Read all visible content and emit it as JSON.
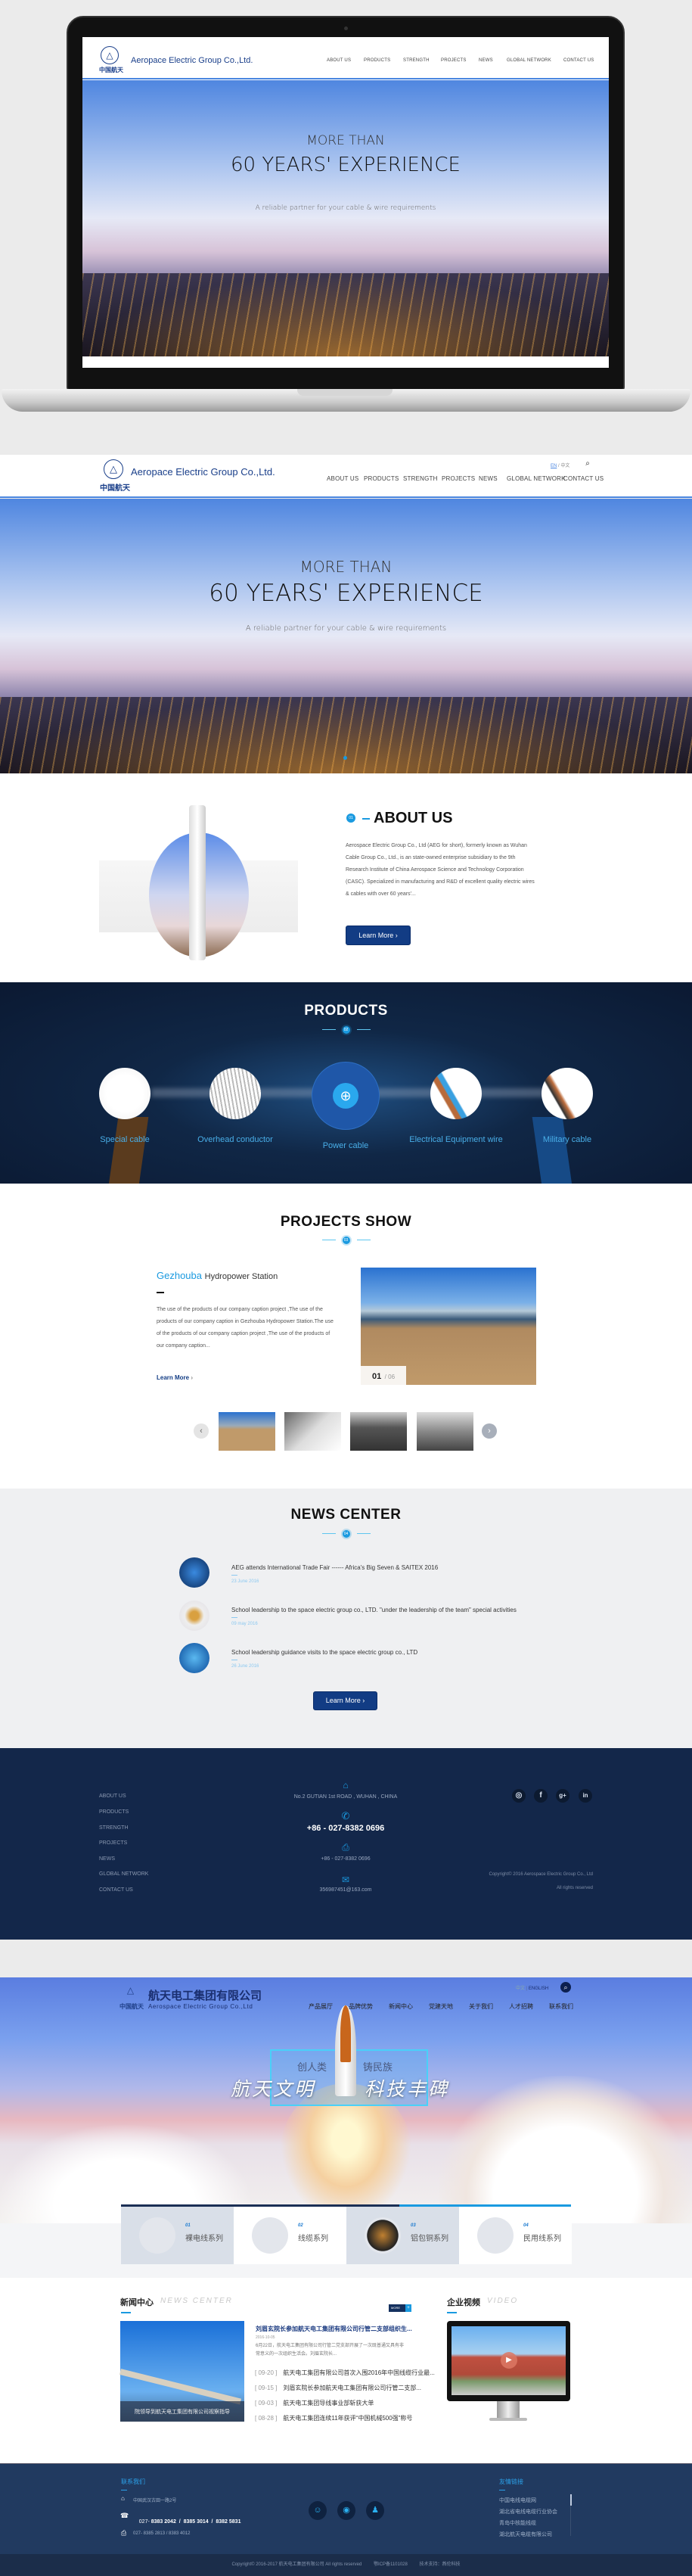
{
  "site": {
    "logo_cn": "中国航天",
    "company_name": "Aeropace Electric Group Co.,Ltd.",
    "lang": {
      "en": "EN",
      "separator": "/",
      "cn": "中文"
    },
    "nav": [
      "ABOUT US",
      "PRODUCTS",
      "STRENGTH",
      "PROJECTS",
      "NEWS",
      "GLOBAL NETWORK",
      "CONTACT US"
    ]
  },
  "hero": {
    "line1": "MORE THAN",
    "line2": "60 YEARS' EXPERIENCE",
    "tagline": "A reliable partner for your cable & wire requirements"
  },
  "about": {
    "number": "01",
    "title": "ABOUT US",
    "text": "Aerospace Electric Group Co., Ltd (AEG for short), formerly known as Wuhan Cable Group Co., Ltd., is an state-owned enterprise subsidiary to the 9th Research Institute of China Aerospace Science and Technology Corporation (CASC). Specialized in manufacturing and R&D of excellent quality electric wires & cables with over 60 years'...",
    "button": "Learn More"
  },
  "products": {
    "title": "PRODUCTS",
    "number": "02",
    "items": [
      "Special cable",
      "Overhead conductor",
      "Power cable",
      "Electrical Equipment wire",
      "Military cable"
    ],
    "active_index": 2
  },
  "projects": {
    "title": "PROJECTS SHOW",
    "number": "03",
    "project_name_highlight": "Gezhouba",
    "project_name_rest": "Hydropower Station",
    "text": "The use of the products of our company caption project ,The use of the products of our company caption in Gezhouba Hydropower Station.The use of the products of our company caption project ,The use of the products of our company caption...",
    "link": "Learn More",
    "counter_current": "01",
    "counter_total": "/ 06"
  },
  "news": {
    "title": "NEWS CENTER",
    "number": "04",
    "items": [
      {
        "title": "AEG attends International Trade Fair ------ Africa's Big Seven & SAITEX 2016",
        "date": "23 June 2016"
      },
      {
        "title": "School leadership to the space electric group co., LTD. \"under the leadership of the team\" special activities",
        "date": "09 may 2016"
      },
      {
        "title": "School leadership guidance visits to the space electric group co., LTD",
        "date": "26 June 2016"
      }
    ],
    "button": "Learn More"
  },
  "footer": {
    "nav": [
      "ABOUT US",
      "PRODUCTS",
      "STRENGTH",
      "PROJECTS",
      "NEWS",
      "GLOBAL NETWORK",
      "CONTACT US"
    ],
    "address": "No.2 GUTIAN 1st ROAD , WUHAN , CHINA",
    "phone": "+86 - 027-8382 0696",
    "fax": "+86 - 027-8382 0696",
    "email": "356987451@163.com",
    "social": [
      "instagram",
      "facebook",
      "google-plus",
      "linkedin"
    ],
    "copyright": "Copyright© 2016 Aerospace Electric Group Co., Ltd",
    "rights": "All rights reserved"
  },
  "cn_site": {
    "logo_cn": "中国航天",
    "company_cn": "航天电工集团有限公司",
    "company_en": "Aerospace Electric Group Co.,Ltd",
    "lang": {
      "cn": "中文",
      "separator": "|",
      "en": "ENGLISH"
    },
    "nav": [
      "产品展厅",
      "品牌优势",
      "新闻中心",
      "党建天地",
      "关于我们",
      "人才招聘",
      "联系我们"
    ],
    "slogan_small_left": "创人类",
    "slogan_small_right": "铸民族",
    "slogan_big_left": "航天文明",
    "slogan_big_right": "科技丰碑",
    "product_cells": [
      {
        "num": "01",
        "name": "裸电线系列"
      },
      {
        "num": "02",
        "name": "线缆系列"
      },
      {
        "num": "03",
        "name": "铝包铜系列"
      },
      {
        "num": "04",
        "name": "民用线系列"
      }
    ],
    "news": {
      "title_cn": "新闻中心",
      "title_en": "NEWS CENTER",
      "more": "MORE",
      "image_caption": "院领导到航天电工集团有限公司视察指导",
      "headline": "刘眉玄院长参加航天电工集团有限公司行管二支部组织生...",
      "headline_date": "2016-10-05",
      "summary": "6月22日，航天电工集团有限公司行管二党支部开展了一次既普通又具有非常意义的一次组织生活会。刘眉玄院长...",
      "list": [
        {
          "date": "[ 09-20 ]",
          "title": "航天电工集团有限公司首次入围2016年中国线缆行业最..."
        },
        {
          "date": "[ 09-15 ]",
          "title": "刘眉玄院长参加航天电工集团有限公司行管二支部..."
        },
        {
          "date": "[ 09-03 ]",
          "title": "航天电工集团导线事业部斩获大单"
        },
        {
          "date": "[ 08-28 ]",
          "title": "航天电工集团连续11年获评“中国机械500强”称号"
        }
      ]
    },
    "video": {
      "title_cn": "企业视频",
      "title_en": "VIDEO"
    },
    "footer": {
      "contact_title": "联系我们",
      "address": "中国武汉古田一路2号",
      "phone_prefix": "027- ",
      "phones": "8383 2042  /  8385 3014  /  8382 5831",
      "fax": "027- 8385 2813  /  8383 4012",
      "social": [
        "wechat",
        "weibo",
        "qq"
      ],
      "links_title": "友情链接",
      "links": [
        "中国电线电缆网",
        "湖北省电线电缆行业协会",
        "青岛中核能线缆",
        "湖北航天电缆有限公司"
      ],
      "copyright": "Copyright© 2016-2017  航天电工集团有限公司 All rights reserved",
      "icp": "鄂ICP备1101028",
      "support": "技术支持：燕伦科技"
    }
  },
  "colors": {
    "brand_navy": "#123c84",
    "accent_blue": "#1a9ae0",
    "footer_bg": "#13274a",
    "products_bg": "#0d1c3a",
    "cn_footer_bg": "#213a60"
  }
}
